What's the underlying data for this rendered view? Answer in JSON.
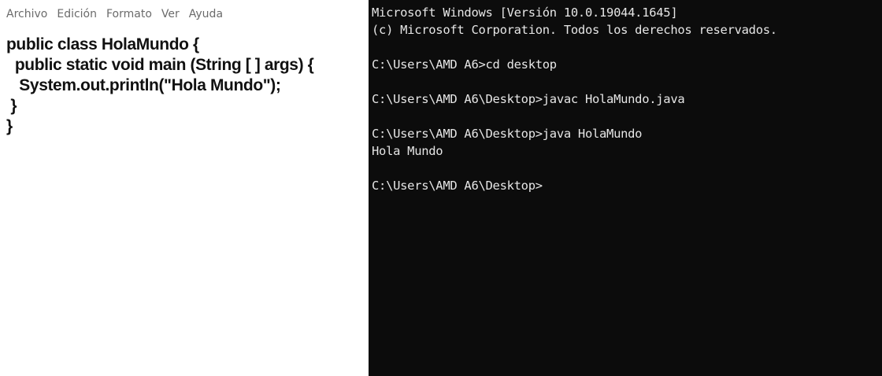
{
  "notepad": {
    "menu": [
      "Archivo",
      "Edición",
      "Formato",
      "Ver",
      "Ayuda"
    ],
    "code": [
      "public class HolaMundo {",
      "  public static void main (String [ ] args) {",
      "   System.out.println(\"Hola Mundo\");",
      " }",
      "}"
    ]
  },
  "console": {
    "lines": [
      "Microsoft Windows [Versión 10.0.19044.1645]",
      "(c) Microsoft Corporation. Todos los derechos reservados.",
      "",
      "C:\\Users\\AMD A6>cd desktop",
      "",
      "C:\\Users\\AMD A6\\Desktop>javac HolaMundo.java",
      "",
      "C:\\Users\\AMD A6\\Desktop>java HolaMundo",
      "Hola Mundo",
      "",
      "C:\\Users\\AMD A6\\Desktop>"
    ],
    "colors": {
      "background": "#0c0c0c",
      "text": "#e6e6e6"
    }
  }
}
